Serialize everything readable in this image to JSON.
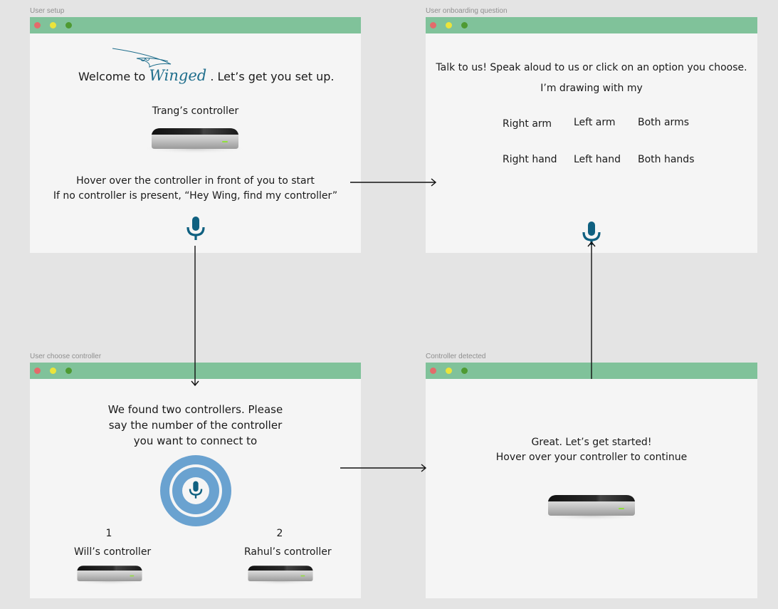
{
  "colors": {
    "titlebar": "#80c29a",
    "mic": "#0f6080",
    "mic_ring": "#6aa2d0",
    "background": "#e4e4e4",
    "window": "#f5f5f5"
  },
  "frames": {
    "setup": {
      "label": "User setup",
      "welcome_prefix": "Welcome to",
      "brand": "Winged",
      "welcome_suffix": ". Let’s get you set up.",
      "controller_name": "Trang’s controller",
      "instruction_1": "Hover over the controller in front of you to start",
      "instruction_2": "If no controller is present, “Hey Wing, find my controller”",
      "icon": "microphone-icon"
    },
    "question": {
      "label": "User onboarding question",
      "prompt": "Talk to us! Speak aloud to us or click on an option you choose.",
      "question": "I’m drawing with my",
      "options": [
        [
          "Right arm",
          "Left arm",
          "Both arms"
        ],
        [
          "Right hand",
          "Left hand",
          "Both hands"
        ]
      ],
      "icon": "microphone-icon"
    },
    "choose": {
      "label": "User choose controller",
      "message_1": "We found two controllers. Please",
      "message_2": "say the number of the controller",
      "message_3": "you want to connect to",
      "icon": "microphone-listening-icon",
      "controllers": [
        {
          "number": "1",
          "name": "Will’s controller"
        },
        {
          "number": "2",
          "name": "Rahul’s controller"
        }
      ]
    },
    "detected": {
      "label": "Controller detected",
      "message_1": "Great. Let’s get started!",
      "message_2": "Hover over your controller to continue"
    }
  },
  "flow": [
    {
      "from": "User setup",
      "to": "User onboarding question"
    },
    {
      "from": "User setup",
      "to": "User choose controller"
    },
    {
      "from": "User choose controller",
      "to": "Controller detected"
    },
    {
      "from": "Controller detected",
      "to": "User onboarding question"
    }
  ]
}
